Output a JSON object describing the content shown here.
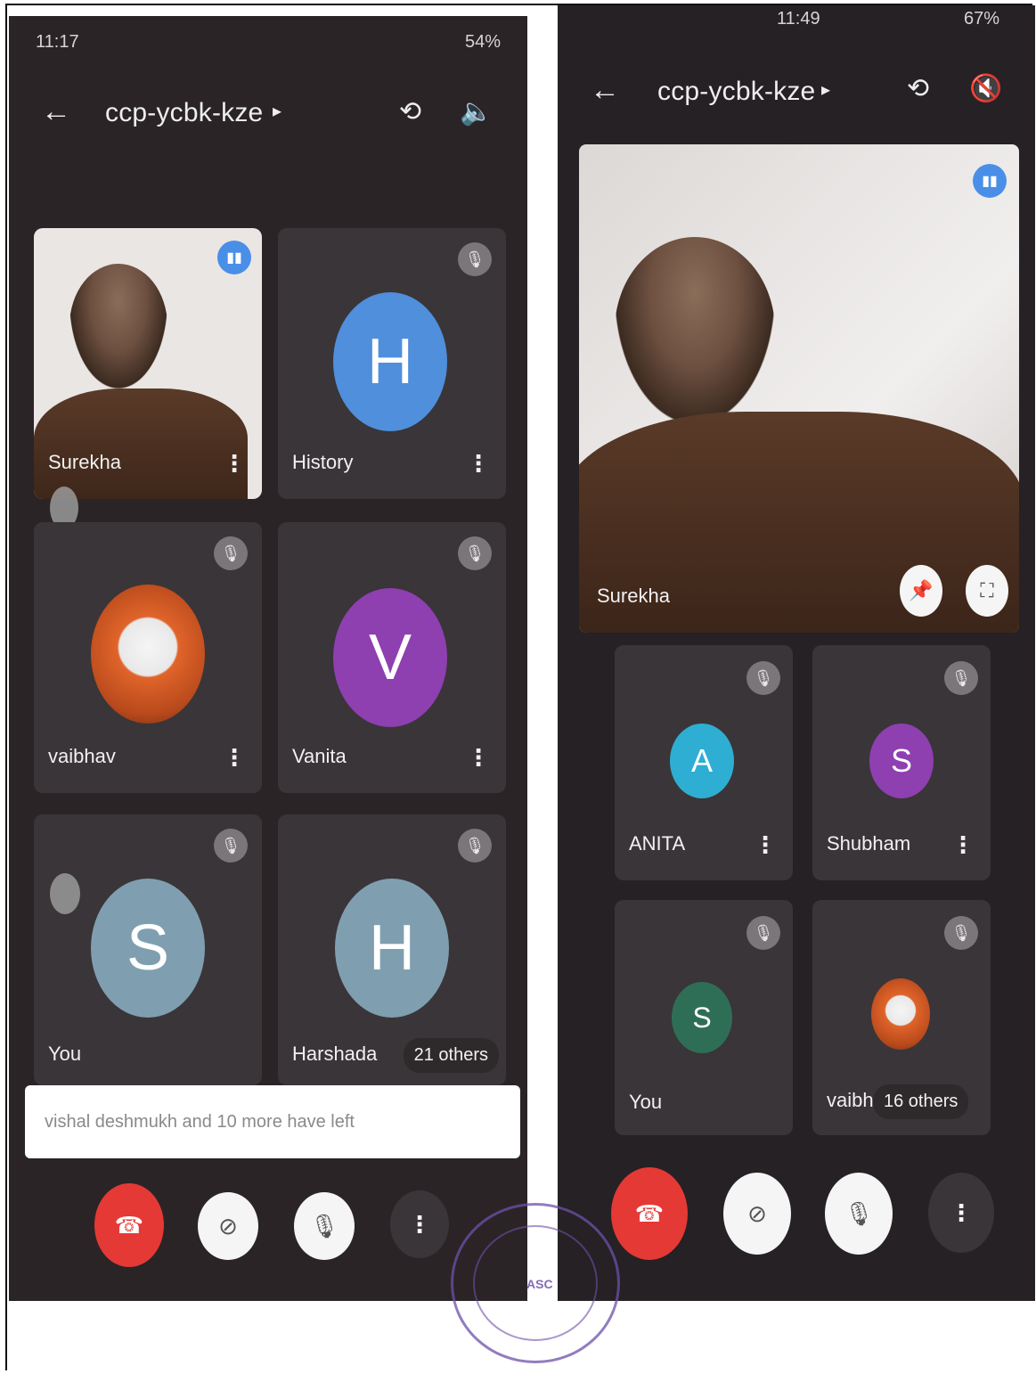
{
  "left": {
    "status": {
      "time": "11:17",
      "battery": "54%"
    },
    "meeting_code": "ccp-ycbk-kze",
    "tiles": [
      {
        "name": "Surekha",
        "type": "video"
      },
      {
        "name": "History",
        "initial": "H",
        "color": "#4f8fdc"
      },
      {
        "name": "vaibhav",
        "type": "avatar-image"
      },
      {
        "name": "Vanita",
        "initial": "V",
        "color": "#8e3fb0"
      },
      {
        "name": "You",
        "initial": "S",
        "color": "#7f9fb0"
      },
      {
        "name": "Harshada",
        "initial": "H",
        "color": "#7f9fb0"
      }
    ],
    "others_label": "21 others",
    "banner": "vishal deshmukh and 10 more have left"
  },
  "right": {
    "status": {
      "time": "11:49",
      "battery": "67%"
    },
    "meeting_code": "ccp-ycbk-kze",
    "featured_name": "Surekha",
    "tiles": [
      {
        "name": "ANITA",
        "initial": "A",
        "color": "#2eaed3"
      },
      {
        "name": "Shubham",
        "initial": "S",
        "color": "#8e3fb0"
      },
      {
        "name": "You",
        "initial": "S",
        "color": "#2f6e56"
      },
      {
        "name": "vaibh",
        "type": "avatar-image"
      }
    ],
    "others_label": "16 others"
  },
  "icons": {
    "back": "arrow-left-icon",
    "switch_camera": "switch-camera-icon",
    "speaker": "speaker-icon",
    "mic_off": "mic-off-icon",
    "end_call": "end-call-icon",
    "camera_off": "camera-off-icon",
    "more": "more-vert-icon",
    "pin": "pin-icon",
    "fullscreen": "fullscreen-icon"
  },
  "stamp": {
    "text": "ASC"
  }
}
